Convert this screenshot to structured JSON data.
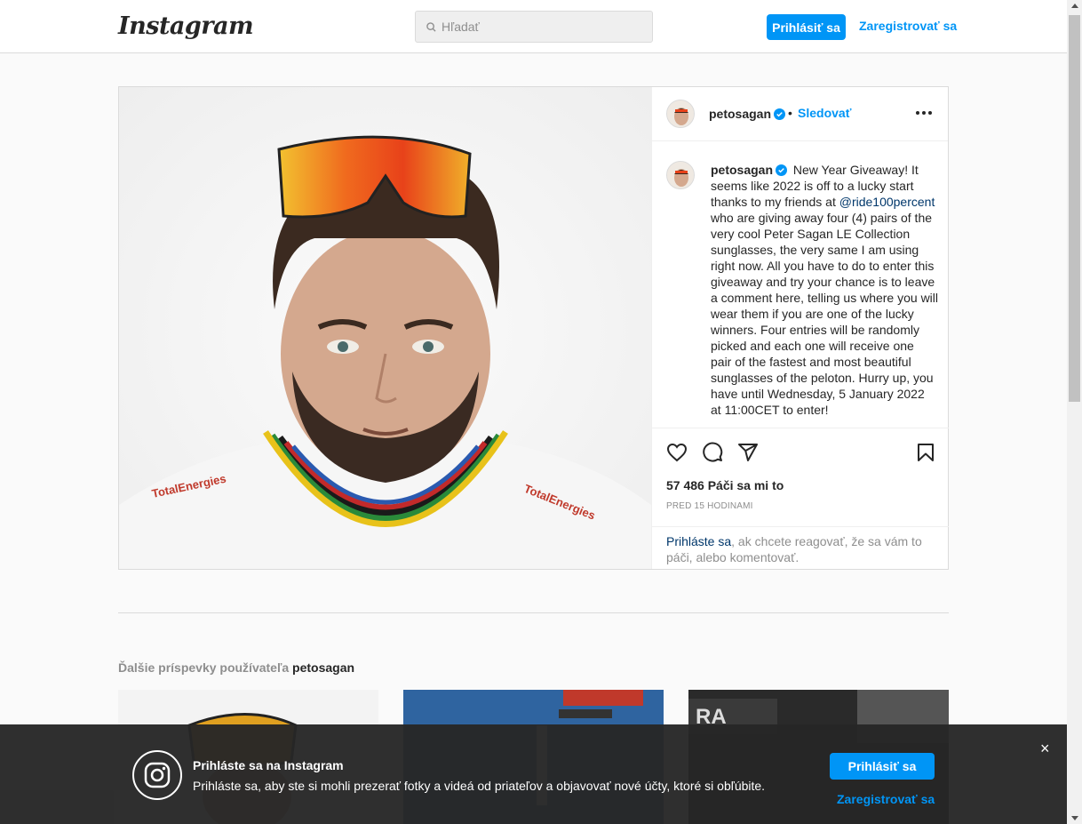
{
  "nav": {
    "logo": "Instagram",
    "search_placeholder": "Hľadať",
    "login_label": "Prihlásiť sa",
    "register_label": "Zaregistrovať sa"
  },
  "post": {
    "username": "petosagan",
    "separator": "•",
    "follow_label": "Sledovať",
    "caption": "New Year Giveaway! It seems like 2022 is off to a lucky start thanks to my friends at",
    "mention": "@ride100percent",
    "caption_rest": "who are giving away four (4) pairs of the very cool Peter Sagan LE Collection sunglasses, the very same I am using right now. All you have to do to enter this giveaway and try your chance is to leave a comment here, telling us where you will wear them if you are one of the lucky winners. Four entries will be randomly picked and each one will receive one pair of the fastest and most beautiful sunglasses of the peloton. Hurry up, you have until Wednesday, 5 January 2022 at 11:00CET to enter!",
    "likes": "57 486 Páči sa mi to",
    "time": "PRED 15 HODINAMI",
    "login_link": "Prihláste sa",
    "login_rest": ", ak chcete reagovať, že sa vám to páči, alebo komentovať.",
    "image_brand": "TotalEnergies"
  },
  "more": {
    "title_prefix": "Ďalšie príspevky používateľa ",
    "title_user": "petosagan"
  },
  "banner": {
    "title": "Prihláste sa na Instagram",
    "text": "Prihláste sa, aby ste si mohli prezerať fotky a videá od priateľov a objavovať nové účty, ktoré si obľúbite.",
    "login_label": "Prihlásiť sa",
    "register_label": "Zaregistrovať sa",
    "close": "×"
  },
  "icons": {
    "verified": "verified-badge-icon",
    "like": "heart-icon",
    "comment": "comment-icon",
    "share": "share-icon",
    "save": "bookmark-icon",
    "more": "more-options-icon",
    "search": "search-icon"
  },
  "colors": {
    "accent": "#0095f6",
    "mention": "#00376b",
    "secondary_text": "#8e8e8e"
  }
}
